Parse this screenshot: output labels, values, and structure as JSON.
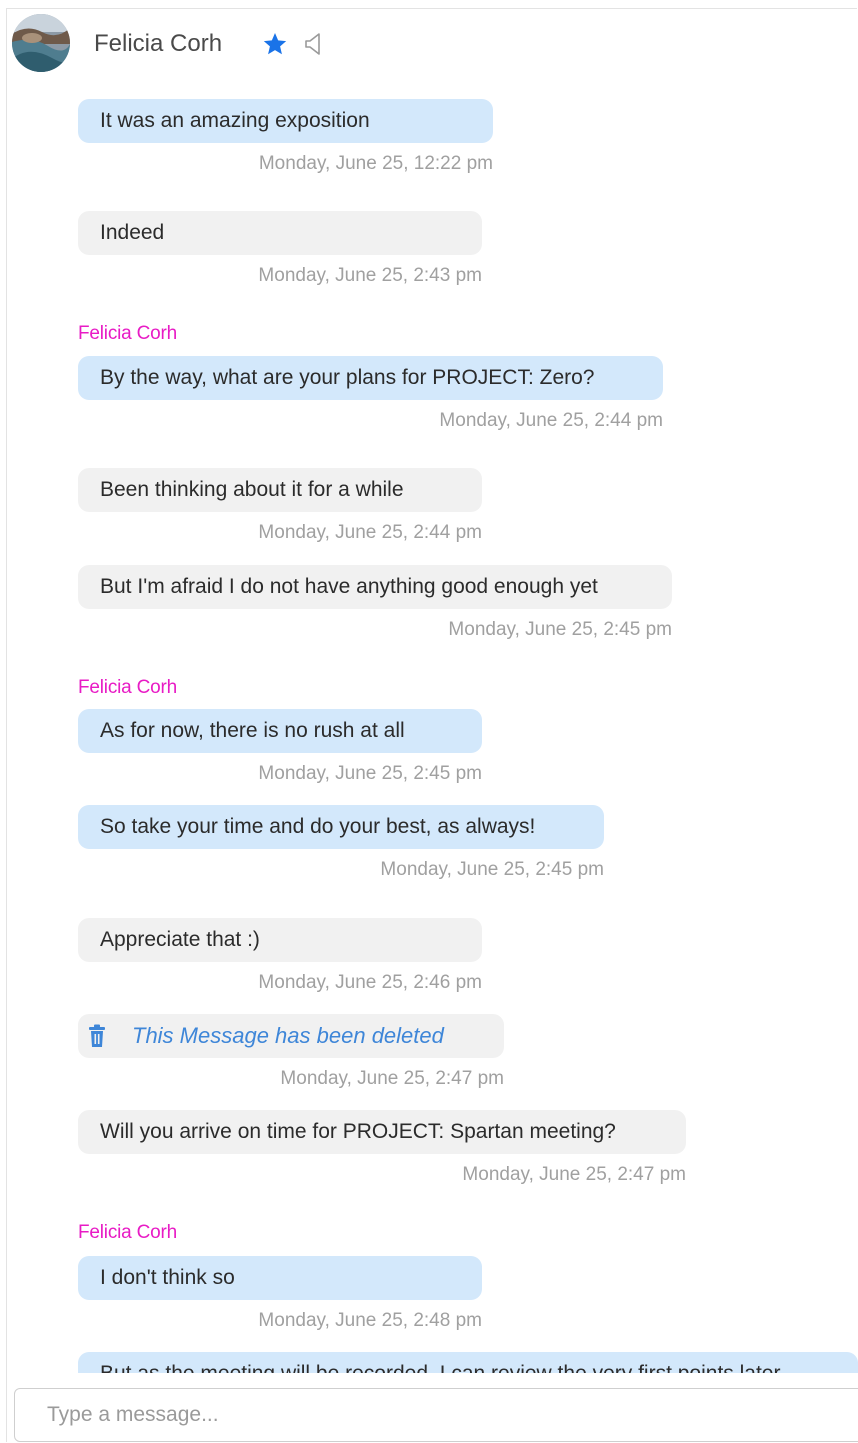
{
  "header": {
    "contact_name": "Felicia Corh",
    "star_color": "#1a73e8",
    "icons": [
      "avatar-photo",
      "star-icon",
      "speaker-muted-icon"
    ]
  },
  "messages": [
    {
      "type": "in",
      "text": "It was an amazing exposition",
      "time": "Monday, June 25, 12:22 pm"
    },
    {
      "type": "out",
      "text": "Indeed",
      "time": "Monday, June 25, 2:43 pm"
    },
    {
      "type": "in",
      "sender": "Felicia Corh",
      "text": "By the way, what are your plans for PROJECT: Zero?",
      "time": "Monday, June 25, 2:44 pm"
    },
    {
      "type": "out",
      "text": "Been thinking about it for a while",
      "time": "Monday, June 25, 2:44 pm"
    },
    {
      "type": "out",
      "text": "But I'm afraid I do not have anything good enough yet",
      "time": "Monday, June 25, 2:45 pm"
    },
    {
      "type": "in",
      "sender": "Felicia Corh",
      "text": "As for now, there is no rush at all",
      "time": "Monday, June 25, 2:45 pm"
    },
    {
      "type": "in",
      "text": "So take your time and do your best, as always!",
      "time": "Monday, June 25, 2:45 pm"
    },
    {
      "type": "out",
      "text": "Appreciate that :)",
      "time": "Monday, June 25, 2:46 pm"
    },
    {
      "type": "deleted",
      "text": "This Message has been deleted",
      "time": "Monday, June 25, 2:47 pm"
    },
    {
      "type": "out",
      "text": "Will you arrive on time for PROJECT: Spartan meeting?",
      "time": "Monday, June 25, 2:47 pm"
    },
    {
      "type": "in",
      "sender": "Felicia Corh",
      "text": "I don't think so",
      "time": "Monday, June 25, 2:48 pm"
    },
    {
      "type": "in",
      "text": "But as the meeting will be recorded, I can review the very first points later",
      "time": ""
    }
  ],
  "composer": {
    "placeholder": "Type a message..."
  },
  "colors": {
    "incoming_bubble": "#d3e8fb",
    "outgoing_bubble": "#f1f1f1",
    "sender_name": "#e81bc5",
    "timestamp": "#a0a0a0",
    "deleted_text": "#3e86d8"
  }
}
